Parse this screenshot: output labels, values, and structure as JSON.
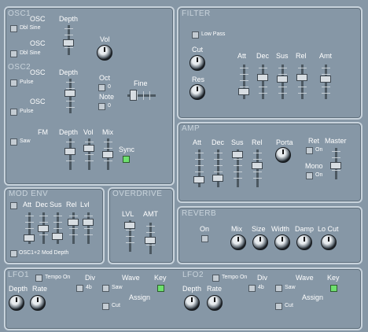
{
  "osc": {
    "title_osc1": "OSC1",
    "title_osc2": "OSC2",
    "osc_label": "OSC",
    "depth_label": "Depth",
    "vol_label": "Vol",
    "dbl_sine": "Dbl Sine",
    "pulse": "Pulse",
    "oct_label": "Oct",
    "note_label": "Note",
    "oct_value": "0",
    "note_value": "0",
    "fine_label": "Fine",
    "fm_label": "FM",
    "saw_label": "Saw",
    "mix_label": "Mix",
    "sync_label": "Sync"
  },
  "filter": {
    "title": "FILTER",
    "lowpass": "Low Pass",
    "cut": "Cut",
    "res": "Res",
    "att": "Att",
    "dec": "Dec",
    "sus": "Sus",
    "rel": "Rel",
    "amt": "Amt"
  },
  "amp": {
    "title": "AMP",
    "att": "Att",
    "dec": "Dec",
    "sus": "Sus",
    "rel": "Rel",
    "porta": "Porta",
    "ret": "Ret",
    "on": "On",
    "mono": "Mono",
    "master": "Master"
  },
  "modenv": {
    "title": "MOD ENV",
    "att": "Att",
    "dec": "Dec",
    "sus": "Sus",
    "rel": "Rel",
    "lvl": "Lvl",
    "osc_mod": "OSC1+2 Mod Depth"
  },
  "overdrive": {
    "title": "OVERDRIVE",
    "lvl": "LVL",
    "amt": "AMT"
  },
  "reverb": {
    "title": "REVERB",
    "on": "On",
    "mix": "Mix",
    "size": "Size",
    "width": "Width",
    "damp": "Damp",
    "locut": "Lo Cut"
  },
  "lfo1": {
    "title": "LFO1",
    "tempo_on": "Tempo On",
    "div": "Div",
    "div_value": "4b",
    "wave": "Wave",
    "saw": "Saw",
    "key": "Key",
    "assign": "Assign",
    "cut": "Cut",
    "depth": "Depth",
    "rate": "Rate"
  },
  "lfo2": {
    "title": "LFO2",
    "tempo_on": "Tempo On",
    "div": "Div",
    "div_value": "4b",
    "wave": "Wave",
    "saw": "Saw",
    "key": "Key",
    "assign": "Assign",
    "cut": "Cut",
    "depth": "Depth",
    "rate": "Rate"
  }
}
